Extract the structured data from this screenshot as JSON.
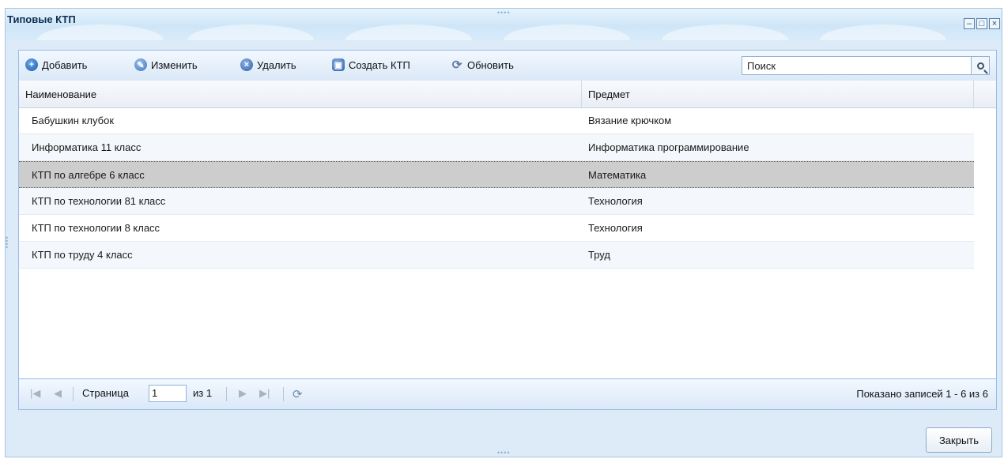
{
  "window": {
    "title": "Типовые КТП",
    "controls": [
      "minimize-icon",
      "maximize-icon",
      "close-icon"
    ]
  },
  "toolbar": {
    "buttons": [
      {
        "label": "Добавить",
        "icon": "add-icon"
      },
      {
        "label": "Изменить",
        "icon": "edit-icon"
      },
      {
        "label": "Удалить",
        "icon": "delete-icon"
      },
      {
        "label": "Создать КТП",
        "icon": "create-icon"
      },
      {
        "label": "Обновить",
        "icon": "refresh-icon"
      }
    ],
    "search": {
      "value": "Поиск"
    }
  },
  "grid": {
    "columns": [
      "Наименование",
      "Предмет"
    ],
    "rows": [
      {
        "name": "Бабушкин клубок",
        "subject": "Вязание крючком"
      },
      {
        "name": "Информатика 11 класс",
        "subject": "Информатика программирование"
      },
      {
        "name": "КТП по алгебре 6 класс",
        "subject": "Математика",
        "selected": true
      },
      {
        "name": "КТП по технологии 81 класс",
        "subject": "Технология"
      },
      {
        "name": "КТП по технологии 8 класс",
        "subject": "Технология"
      },
      {
        "name": "КТП по труду 4 класс",
        "subject": "Труд"
      }
    ]
  },
  "pager": {
    "page_label": "Страница",
    "page_value": "1",
    "of_label": "из 1",
    "status": "Показано записей 1 - 6 из 6"
  },
  "footer": {
    "close_label": "Закрыть"
  },
  "colors": {
    "window_bg": "#dcebf7",
    "border": "#99bbe8",
    "selected_row": "#cdcdcd"
  }
}
